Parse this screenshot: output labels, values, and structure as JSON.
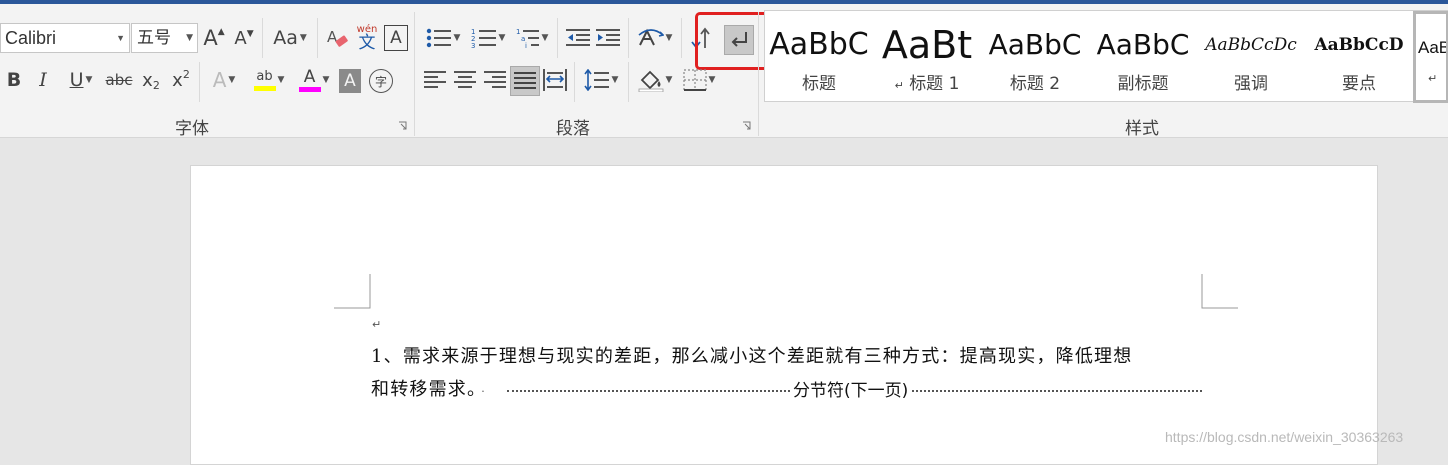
{
  "ribbon": {
    "font_group": {
      "label": "字体",
      "font_name": "Calibri",
      "font_size": "五号",
      "grow_font": "A",
      "shrink_font": "A",
      "change_case": "Aa",
      "phonetic_top": "wén",
      "phonetic_bottom": "文",
      "char_border": "A",
      "bold": "B",
      "italic": "I",
      "underline": "U",
      "strikethrough": "abc",
      "subscript": "x",
      "subscript_mark": "2",
      "superscript": "x",
      "superscript_mark": "2",
      "text_effects": "A",
      "highlight": "ab",
      "font_color": "A",
      "char_shading": "A",
      "enclose_char": "字",
      "highlight_color": "#ffff00",
      "font_color_value": "#ff00ff"
    },
    "paragraph_group": {
      "label": "段落"
    },
    "styles_group": {
      "label": "样式",
      "items": [
        {
          "preview": "AaBbC",
          "name": "标题"
        },
        {
          "preview": "AaBt",
          "name": "标题 1",
          "mark": "↵"
        },
        {
          "preview": "AaBbC",
          "name": "标题 2"
        },
        {
          "preview": "AaBbC",
          "name": "副标题"
        },
        {
          "preview": "AaBbCcDc",
          "name": "强调"
        },
        {
          "preview": "AaBbCcD",
          "name": "要点"
        },
        {
          "preview": "AaB",
          "name": "↵"
        }
      ]
    }
  },
  "document": {
    "empty_paragraph_mark": "↵",
    "line1": "1、需求来源于理想与现实的差距，那么减小这个差距就有三种方式：提高现实，降低理想",
    "line2": "和转移需求。",
    "space_dot": "·",
    "section_break": "分节符(下一页)"
  },
  "watermark": "https://blog.csdn.net/weixin_30363263",
  "colors": {
    "title_bar": "#2b579a",
    "highlight_box": "#e02020"
  }
}
